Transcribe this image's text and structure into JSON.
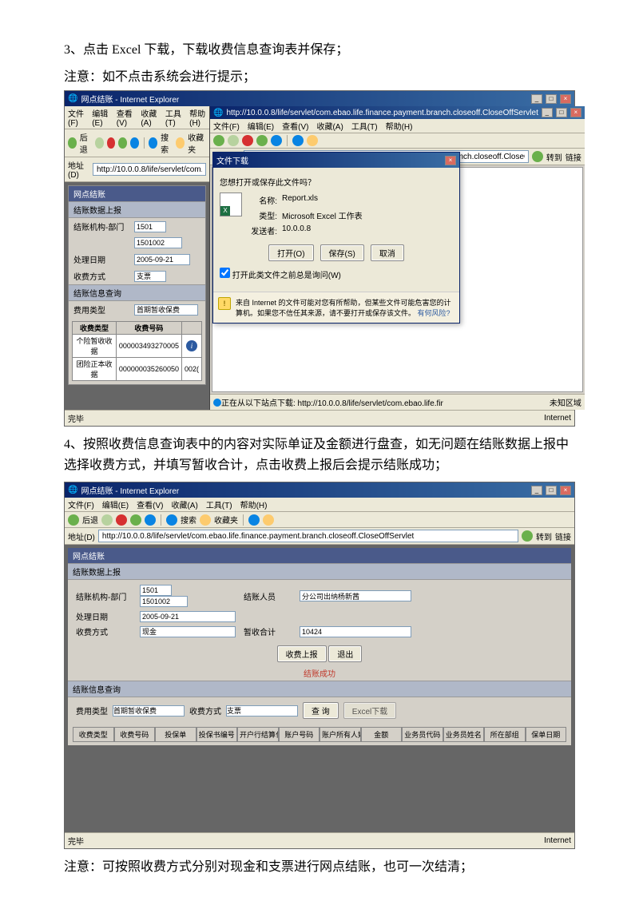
{
  "step3": "3、点击 Excel 下载，下载收费信息查询表并保存；",
  "note1": "注意：如不点击系统会进行提示；",
  "step4": "4、按照收费信息查询表中的内容对实际单证及金额进行盘查，如无问题在结账数据上报中选择收费方式，并填写暂收合计，点击收费上报后会提示结账成功；",
  "note2": "注意：可按照收费方式分别对现金和支票进行网点结账，也可一次结清；",
  "ie": {
    "title1": "网点结账 - Internet Explorer",
    "title2_url": "http://10.0.0.8/life/servlet/com.ebao.life.finance.payment.branch.closeoff.CloseOffServlet",
    "menu_file": "文件(F)",
    "menu_edit": "编辑(E)",
    "menu_view": "查看(V)",
    "menu_fav": "收藏(A)",
    "menu_tools": "工具(T)",
    "menu_help": "帮助(H)",
    "back": "后退",
    "search": "搜索",
    "favorites": "收藏夹",
    "addr_label": "地址(D)",
    "addr": "http://10.0.0.8/life/servlet/com.ebao.life.finance.payment.branch.closeoff.CloseOffServlet",
    "addr_short": "http://10.0.0.8/life/servlet/com.ebao.life.finance.payment.bran",
    "go": "转到",
    "links": "链接",
    "status_done": "完毕",
    "status_zone": "Internet",
    "status_unknown": "未知区域",
    "status_downloading": "正在从以下站点下载: http://10.0.0.8/life/servlet/com.ebao.life.fir"
  },
  "app": {
    "title": "网点结账",
    "section_upload": "结账数据上报",
    "section_query": "结账信息查询",
    "lbl_org": "结账机构-部门",
    "val_org1": "1501",
    "val_org2": "1501002",
    "lbl_date": "处理日期",
    "val_date": "2005-09-21",
    "lbl_method": "收费方式",
    "val_method": "支票",
    "lbl_feetype": "费用类型",
    "val_feetype": "首期暂收保费",
    "tbl_h1": "收费类型",
    "tbl_h2": "收费号码",
    "r1c1": "个险暂收收据",
    "r1c2": "000003493270005",
    "r2c1": "团险正本收据",
    "r2c2": "000000035260050",
    "r_ex": "002(",
    "lbl_person": "结账人员",
    "val_person": "分公司出纳杨新茜",
    "lbl_tempsum": "暂收合计",
    "val_tempsum": "10424",
    "val_method2": "现金",
    "btn_report": "收费上报",
    "btn_exit": "退出",
    "success_msg": "结账成功",
    "btn_query": "查 询",
    "btn_excel": "Excel下载",
    "val_method_q": "支票"
  },
  "cols": [
    "收费类型",
    "收费号码",
    "投保单",
    "投保书编号",
    "开户行结算代号代码",
    "账户号码",
    "账户所有人姓名",
    "金额",
    "业务员代码",
    "业务员姓名",
    "所在部组",
    "保单日期"
  ],
  "dl": {
    "title": "文件下载",
    "q": "您想打开或保存此文件吗？",
    "k_name": "名称:",
    "v_name": "Report.xls",
    "k_type": "类型:",
    "v_type": "Microsoft Excel 工作表",
    "k_from": "发送者:",
    "v_from": "10.0.0.8",
    "btn_open": "打开(O)",
    "btn_save": "保存(S)",
    "btn_cancel": "取消",
    "chk": "打开此类文件之前总是询问(W)",
    "warn": "来自 Internet 的文件可能对您有所帮助，但某些文件可能危害您的计算机。如果您不信任其来源，请不要打开或保存该文件。",
    "warn_link": "有何风险?"
  }
}
